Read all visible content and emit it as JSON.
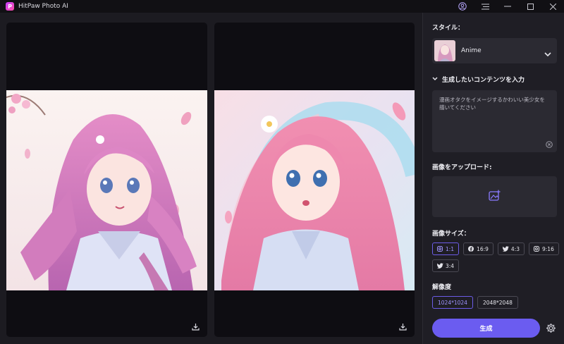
{
  "app": {
    "title": "HitPaw Photo AI",
    "logo_letter": "P"
  },
  "panel": {
    "style_label": "スタイル：",
    "style_value": "Anime",
    "prompt_toggle_label": "生成したいコンテンツを入力",
    "prompt_text": "漫画オタクをイメージするかわいい美少女を描いてください",
    "upload_label": "画像をアップロード:",
    "size_label": "画像サイズ：",
    "sizes": [
      {
        "label": "1:1",
        "icon": "instagram-icon",
        "selected": true
      },
      {
        "label": "16:9",
        "icon": "facebook-icon",
        "selected": false
      },
      {
        "label": "4:3",
        "icon": "twitter-icon",
        "selected": false
      },
      {
        "label": "9:16",
        "icon": "instagram-icon",
        "selected": false
      },
      {
        "label": "3:4",
        "icon": "twitter-icon",
        "selected": false
      }
    ],
    "resolution_label": "解像度",
    "resolutions": [
      {
        "label": "1024*1024",
        "selected": true
      },
      {
        "label": "2048*2048",
        "selected": false
      }
    ],
    "generate_label": "生成"
  },
  "colors": {
    "accent": "#6b5cf0",
    "accent_text": "#9f94ff",
    "background": "#1c1b21",
    "panel": "#1f1e25"
  }
}
